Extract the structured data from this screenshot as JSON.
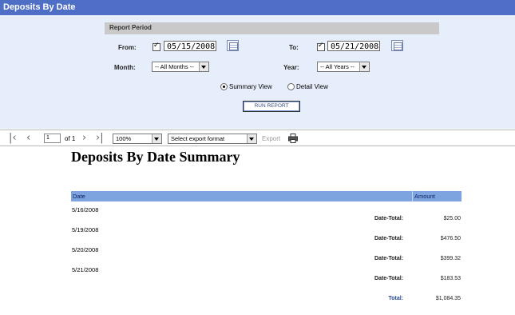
{
  "window": {
    "title": "Deposits By Date"
  },
  "params": {
    "section_title": "Report Period",
    "from_label": "From:",
    "from_value": "05/15/2008",
    "from_checked": true,
    "to_label": "To:",
    "to_value": "05/21/2008",
    "to_checked": true,
    "month_label": "Month:",
    "month_value": "-- All Months --",
    "year_label": "Year:",
    "year_value": "-- All Years --",
    "view_options": [
      {
        "label": "Summary View",
        "selected": true
      },
      {
        "label": "Detail View",
        "selected": false
      }
    ],
    "run_button": "RUN REPORT"
  },
  "toolbar": {
    "page_value": "1",
    "page_of": "of 1",
    "zoom_value": "100%",
    "export_format_placeholder": "Select export format",
    "export_label": "Export",
    "icons": [
      "first-page-icon",
      "prev-page-icon",
      "next-page-icon",
      "last-page-icon",
      "printer-icon"
    ]
  },
  "report": {
    "title": "Deposits By Date Summary",
    "columns": [
      "Date",
      "Amount"
    ],
    "rows": [
      {
        "date": "5/16/2008",
        "total_label": "Date-Total:",
        "total": "$25.00"
      },
      {
        "date": "5/19/2008",
        "total_label": "Date-Total:",
        "total": "$476.50"
      },
      {
        "date": "5/20/2008",
        "total_label": "Date-Total:",
        "total": "$399.32"
      },
      {
        "date": "5/21/2008",
        "total_label": "Date-Total:",
        "total": "$183.53"
      }
    ],
    "grand_total_label": "Total:",
    "grand_total": "$1,084.35"
  },
  "colors": {
    "titlebar": "#4f6fc7",
    "params_bg": "#e7eefb",
    "table_header": "#7ea4e0"
  }
}
